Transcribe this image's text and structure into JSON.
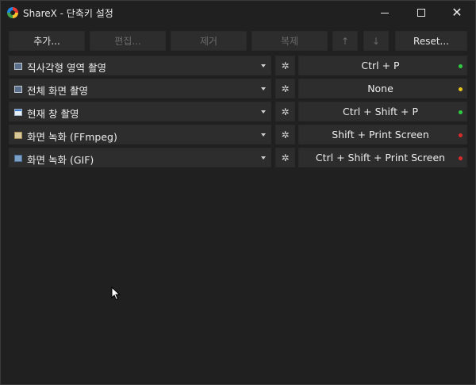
{
  "window": {
    "title": "ShareX - 단축키 설정",
    "minimize_icon": "minimize-icon",
    "maximize_icon": "maximize-icon",
    "close_symbol": "✕"
  },
  "toolbar": {
    "add_label": "추가...",
    "edit_label": "편집...",
    "remove_label": "제거",
    "duplicate_label": "복제",
    "move_up_label": "↑",
    "move_down_label": "↓",
    "reset_label": "Reset..."
  },
  "hotkeys": [
    {
      "task": "직사각형 영역 촬영",
      "icon": "region-capture-icon",
      "hotkey": "Ctrl + P",
      "status_color": "#2ecc40"
    },
    {
      "task": "전체 화면 촬영",
      "icon": "fullscreen-capture-icon",
      "hotkey": "None",
      "status_color": "#e6c619"
    },
    {
      "task": "현재 창 촬영",
      "icon": "window-capture-icon",
      "hotkey": "Ctrl + Shift + P",
      "status_color": "#2ecc40"
    },
    {
      "task": "화면 녹화 (FFmpeg)",
      "icon": "screen-record-icon",
      "hotkey": "Shift + Print Screen",
      "status_color": "#d92b2b"
    },
    {
      "task": "화면 녹화 (GIF)",
      "icon": "gif-record-icon",
      "hotkey": "Ctrl + Shift + Print Screen",
      "status_color": "#d92b2b"
    }
  ],
  "gear_symbol": "✲",
  "colors": {
    "background": "#202020",
    "control": "#2d2d2d",
    "text": "#e8e8e8",
    "disabled_text": "#6a6a6a"
  }
}
